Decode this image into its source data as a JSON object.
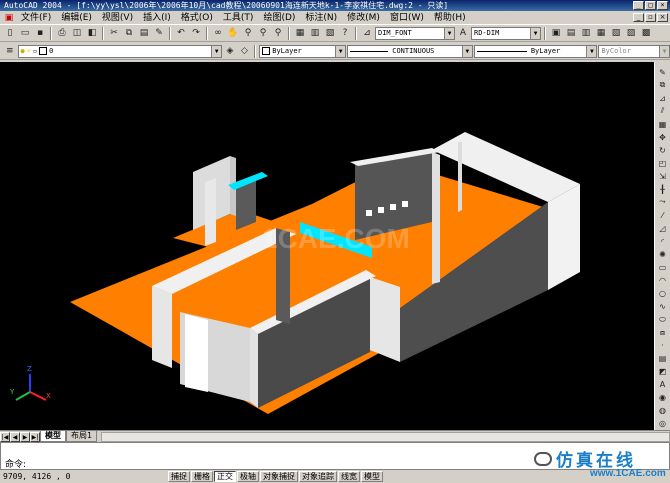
{
  "window": {
    "title": "AutoCAD 2004 - [f:\\yy\\ysl\\2006年\\2006年10月\\cad教程\\20060901海连新天地k-1-李家祺住宅.dwg:2 - 只读]"
  },
  "menu": {
    "items": [
      "文件(F)",
      "编辑(E)",
      "视图(V)",
      "插入(I)",
      "格式(O)",
      "工具(T)",
      "绘图(D)",
      "标注(N)",
      "修改(M)",
      "窗口(W)",
      "帮助(H)"
    ]
  },
  "toolbar1": {
    "dimstyle": "DIM_FONT",
    "textstyle": "RD-DIM"
  },
  "toolbar2": {
    "layer": "0",
    "color": "ByLayer",
    "linetype": "CONTINUOUS",
    "lineweight": "ByLayer",
    "plotstyle": "ByColor"
  },
  "viewport": {
    "watermark": "1CAE.COM",
    "ucs_labels": {
      "z": "Z",
      "y": "Y",
      "x": "X"
    }
  },
  "tabs": {
    "model": "模型",
    "layout1": "布局1"
  },
  "command": {
    "prompt": "命令:"
  },
  "status": {
    "coords": "9709, 4126 , 0",
    "buttons": [
      {
        "label": "捕捉",
        "on": false
      },
      {
        "label": "栅格",
        "on": false
      },
      {
        "label": "正交",
        "on": true
      },
      {
        "label": "极轴",
        "on": false
      },
      {
        "label": "对象捕捉",
        "on": false
      },
      {
        "label": "对象追踪",
        "on": false
      },
      {
        "label": "线宽",
        "on": false
      },
      {
        "label": "模型",
        "on": false
      }
    ]
  },
  "branding": {
    "cn": "仿真在线",
    "url": "www.1CAE.com"
  },
  "colors": {
    "floor": "#ff7f00",
    "wall_top": "#e8e8e8",
    "wall_side": "#4a4a4a",
    "beam": "#00e5ff"
  }
}
